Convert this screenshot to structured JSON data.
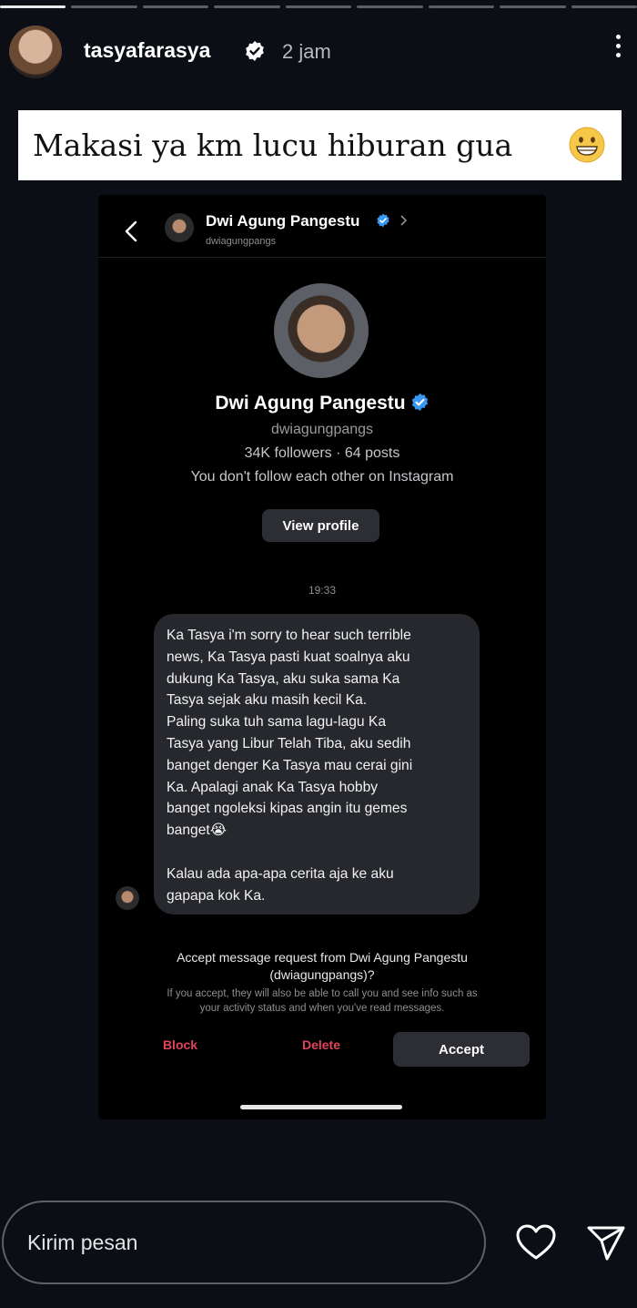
{
  "story": {
    "segments": 9,
    "active_segments": 1,
    "username": "tasyafarasya",
    "time": "2 jam",
    "caption": "Makasi ya km lucu hiburan gua"
  },
  "dm": {
    "header_name": "Dwi Agung Pangestu",
    "header_handle": "dwiagungpangs",
    "profile_name": "Dwi Agung Pangestu",
    "profile_handle": "dwiagungpangs",
    "stats": "34K followers · 64 posts",
    "follow_status": "You don't follow each other on Instagram",
    "view_profile": "View profile",
    "timestamp": "19:33",
    "message_lines": [
      "Ka Tasya i'm sorry to hear such terrible",
      "news, Ka Tasya pasti kuat soalnya aku",
      "dukung Ka Tasya, aku suka sama Ka",
      "Tasya sejak aku masih kecil Ka.",
      "Paling suka tuh sama lagu-lagu Ka",
      "Tasya yang Libur Telah Tiba, aku sedih",
      "banget denger Ka Tasya mau cerai gini",
      "Ka. Apalagi anak Ka Tasya hobby",
      "banget ngoleksi kipas angin itu gemes",
      "banget😭",
      "",
      "Kalau ada apa-apa cerita aja ke aku",
      "gapapa kok Ka."
    ],
    "request_title_1": "Accept message request from Dwi Agung Pangestu",
    "request_title_2": "(dwiagungpangs)?",
    "request_note_1": "If you accept, they will also be able to call you and see info such as",
    "request_note_2": "your activity status and when you've read messages.",
    "block": "Block",
    "delete": "Delete",
    "accept": "Accept"
  },
  "reply": {
    "placeholder": "Kirim pesan"
  },
  "icons": {
    "verified": "verified-badge-icon",
    "more": "more-vertical-icon",
    "back": "chevron-left-icon",
    "heart": "heart-icon",
    "send": "send-icon",
    "emoji": "grinning-face-icon"
  },
  "colors": {
    "background": "#0b0e14",
    "verified_blue": "#3897f0",
    "danger": "#e0445b"
  }
}
